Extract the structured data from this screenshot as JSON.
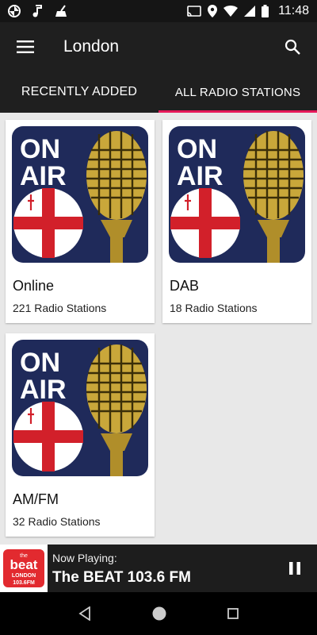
{
  "status_bar": {
    "time": "11:48",
    "left_icons": [
      "pinwheel-icon",
      "music-note-icon",
      "broom-icon"
    ],
    "right_icons": [
      "cast-icon",
      "location-icon",
      "wifi-icon",
      "signal-icon",
      "battery-icon"
    ]
  },
  "app_bar": {
    "title": "London"
  },
  "tabs": [
    {
      "label": "RECENTLY ADDED",
      "active": false
    },
    {
      "label": "ALL RADIO STATIONS",
      "active": true
    }
  ],
  "cards": [
    {
      "title": "Online",
      "subtitle": "221 Radio Stations",
      "image": {
        "line1": "ON",
        "line2": "AIR"
      }
    },
    {
      "title": "DAB",
      "subtitle": "18 Radio Stations",
      "image": {
        "line1": "ON",
        "line2": "AIR"
      }
    },
    {
      "title": "AM/FM",
      "subtitle": "32 Radio Stations",
      "image": {
        "line1": "ON",
        "line2": "AIR"
      }
    }
  ],
  "player": {
    "now_playing_label": "Now Playing:",
    "station": "The BEAT 103.6 FM",
    "logo": {
      "top": "the",
      "main": "beat",
      "city": "LONDON",
      "freq": "103.6FM"
    }
  },
  "colors": {
    "accent": "#e6195a",
    "toolbar": "#1f1f1f",
    "poster_bg": "#1f2a5a",
    "cross_red": "#d2202a",
    "mic_gold": "#c9a73a"
  }
}
